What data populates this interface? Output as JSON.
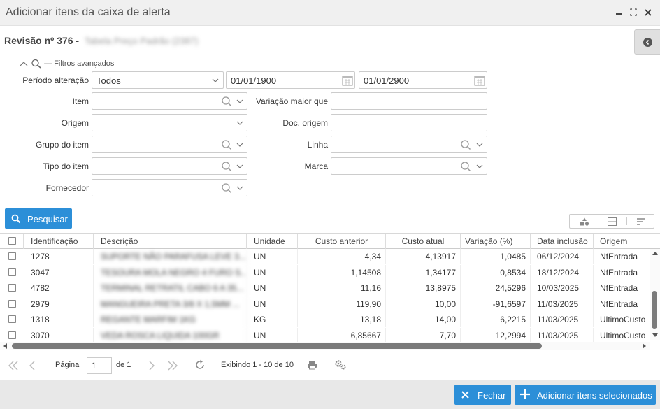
{
  "window": {
    "title": "Adicionar itens da caixa de alerta"
  },
  "revision": {
    "label": "Revisão nº 376 -",
    "name": "Tabela Preço Padrão (2387)"
  },
  "filters": {
    "toggle_label": "— Filtros avançados",
    "periodo": {
      "label": "Período alteração",
      "value": "Todos",
      "from": "01/01/1900",
      "to": "01/01/2900"
    },
    "item": {
      "label": "Item"
    },
    "variacao": {
      "label": "Variação maior que"
    },
    "origem": {
      "label": "Origem"
    },
    "doc_origem": {
      "label": "Doc. origem"
    },
    "grupo": {
      "label": "Grupo do item"
    },
    "linha": {
      "label": "Linha"
    },
    "tipo": {
      "label": "Tipo do item"
    },
    "marca": {
      "label": "Marca"
    },
    "fornecedor": {
      "label": "Fornecedor"
    }
  },
  "search_button": "Pesquisar",
  "grid": {
    "columns": [
      "Identificação",
      "Descrição",
      "Unidade",
      "Custo anterior",
      "Custo atual",
      "Variação (%)",
      "Data inclusão",
      "Origem"
    ],
    "rows": [
      {
        "id": "1278",
        "desc": "SUPORTE NÃO PARAFUSA LEVE 3...",
        "un": "UN",
        "anterior": "4,34",
        "atual": "4,13917",
        "var": "1,0485",
        "data": "06/12/2024",
        "origem": "NfEntrada"
      },
      {
        "id": "3047",
        "desc": "TESOURA MOLA NEGRO 4 FURO S...",
        "un": "UN",
        "anterior": "1,14508",
        "atual": "1,34177",
        "var": "0,8534",
        "data": "18/12/2024",
        "origem": "NfEntrada"
      },
      {
        "id": "4782",
        "desc": "TERMINAL RETRATIL CABO 6 A 35...",
        "un": "UN",
        "anterior": "11,16",
        "atual": "13,8975",
        "var": "24,5296",
        "data": "10/03/2025",
        "origem": "NfEntrada"
      },
      {
        "id": "2979",
        "desc": "MANGUEIRA PRETA 3/8 X 1,5MM ...",
        "un": "UN",
        "anterior": "119,90",
        "atual": "10,00",
        "var": "-91,6597",
        "data": "11/03/2025",
        "origem": "NfEntrada"
      },
      {
        "id": "1318",
        "desc": "REGANTE MARFIM 1KG",
        "un": "KG",
        "anterior": "13,18",
        "atual": "14,00",
        "var": "6,2215",
        "data": "11/03/2025",
        "origem": "UltimoCusto"
      },
      {
        "id": "3070",
        "desc": "VEDA ROSCA LIQUIDA 100GR",
        "un": "UN",
        "anterior": "6,85667",
        "atual": "7,70",
        "var": "12,2994",
        "data": "11/03/2025",
        "origem": "UltimoCusto"
      }
    ]
  },
  "pager": {
    "page_label": "Página",
    "page_value": "1",
    "of_label": "de 1",
    "showing": "Exibindo 1 - 10 de 10"
  },
  "footer": {
    "close": "Fechar",
    "add": "Adicionar itens selecionados"
  },
  "colors": {
    "primary": "#2c8fd8",
    "link": "#2a7fc4",
    "negative_var": "#4e9a3a",
    "positive_var": "#a01a1a"
  }
}
